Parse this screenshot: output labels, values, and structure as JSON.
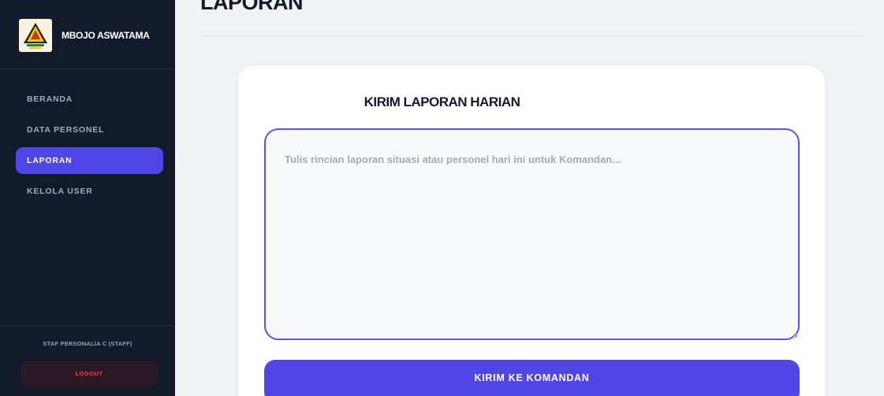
{
  "brand": {
    "name": "MBOJO ASWATAMA",
    "logo_icon": "district-emblem-icon"
  },
  "sidebar": {
    "items": [
      {
        "label": "BERANDA",
        "active": false
      },
      {
        "label": "DATA PERSONEL",
        "active": false
      },
      {
        "label": "LAPORAN",
        "active": true
      },
      {
        "label": "KELOLA USER",
        "active": false
      }
    ],
    "user_label": "STAF PERSONALIA C (STAFF)",
    "logout_label": "LOGOUT"
  },
  "header": {
    "title": "LAPORAN"
  },
  "form": {
    "title": "KIRIM LAPORAN HARIAN",
    "textarea": {
      "value": "",
      "placeholder": "Tulis rincian laporan situasi atau personel hari ini untuk Komandan..."
    },
    "submit_label": "KIRIM KE KOMANDAN"
  },
  "colors": {
    "sidebar_bg": "#131a2b",
    "accent": "#4f46e5",
    "page_bg": "#f1f2f5",
    "logout_text": "#ef4444"
  }
}
